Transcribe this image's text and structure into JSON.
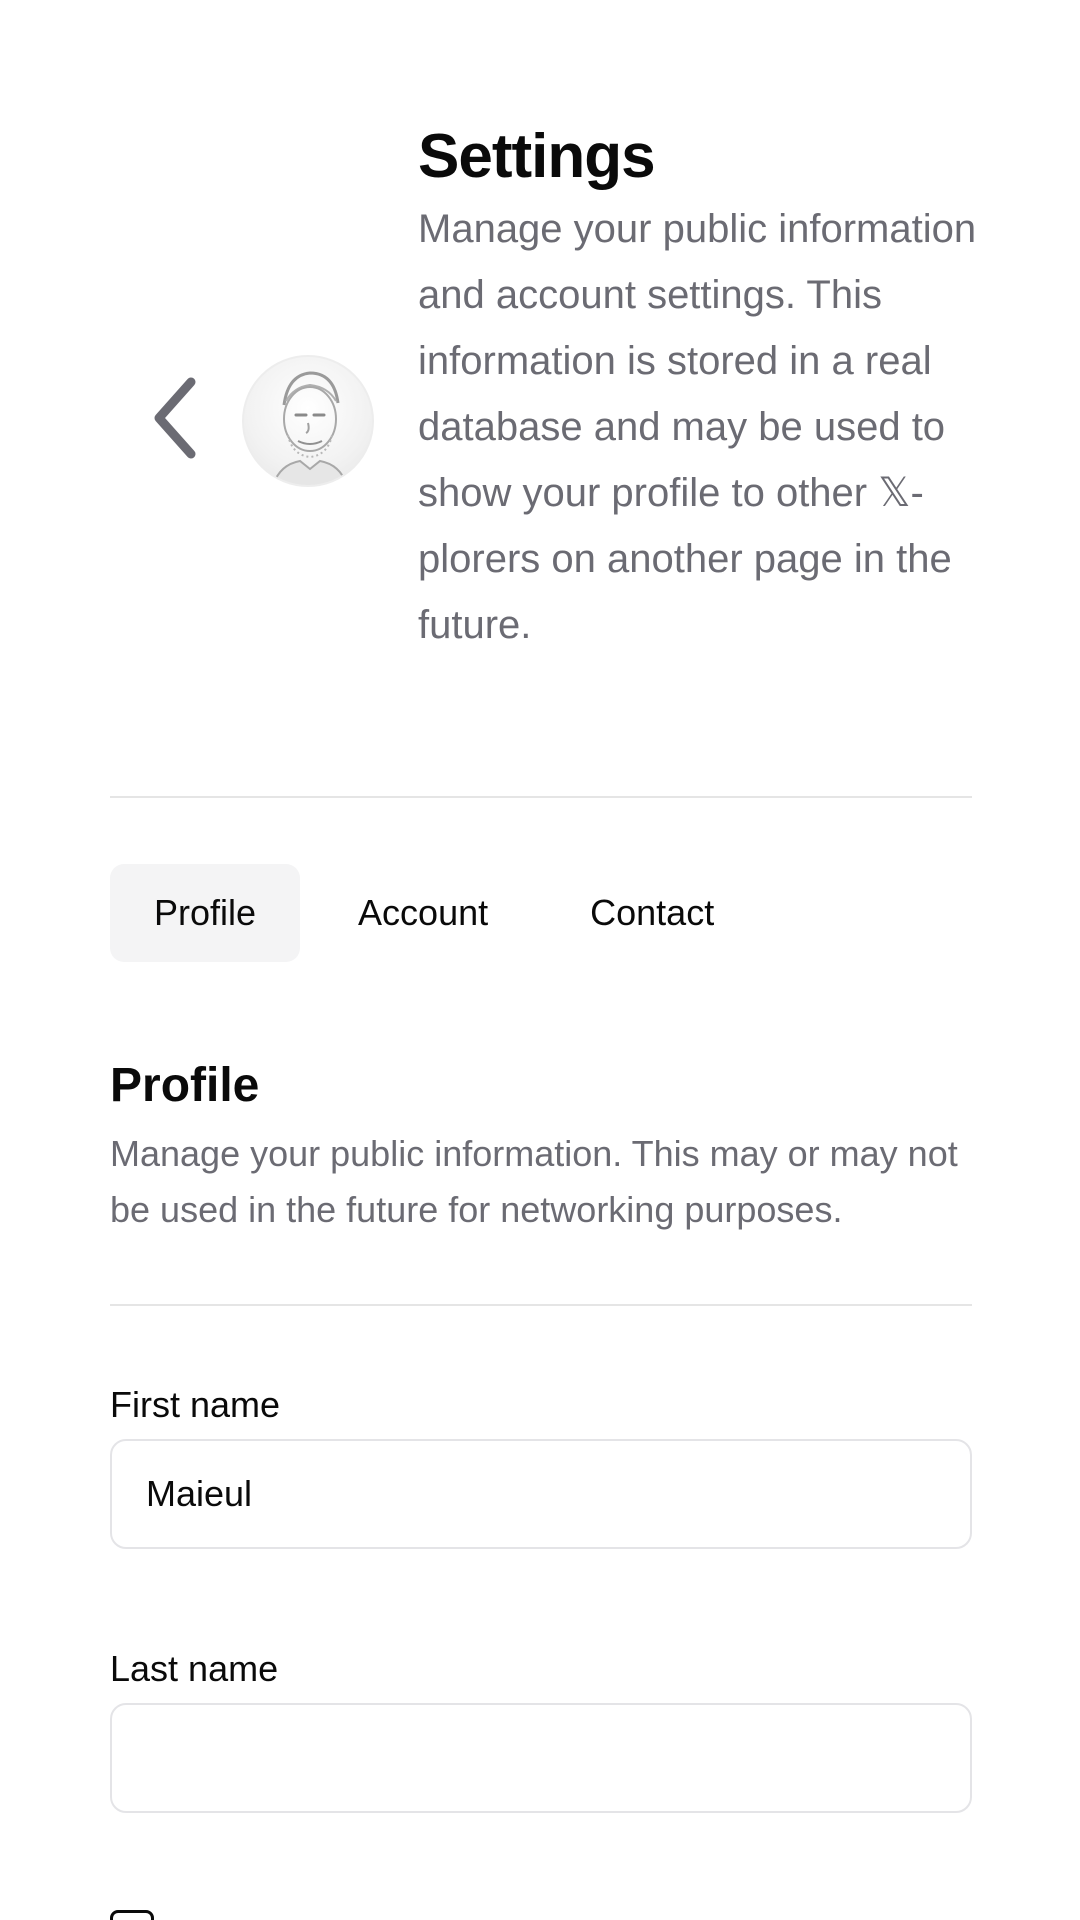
{
  "header": {
    "title": "Settings",
    "description": "Manage your public information and account settings. This information is stored in a real database and may be used to show your profile to other 𝕏-plorers on another page in the future."
  },
  "tabs": [
    {
      "label": "Profile",
      "active": true
    },
    {
      "label": "Account",
      "active": false
    },
    {
      "label": "Contact",
      "active": false
    }
  ],
  "section": {
    "title": "Profile",
    "description": "Manage your public information. This may or may not be used in the future for networking purposes."
  },
  "fields": {
    "first_name": {
      "label": "First name",
      "value": "Maieul"
    },
    "last_name": {
      "label": "Last name",
      "value": ""
    }
  },
  "icons": {
    "back": "chevron-left-icon",
    "avatar": "user-avatar"
  },
  "colors": {
    "text_primary": "#0a0a0a",
    "text_muted": "#6b6b73",
    "active_tab_bg": "#f4f4f5",
    "border": "#e4e4e7"
  }
}
